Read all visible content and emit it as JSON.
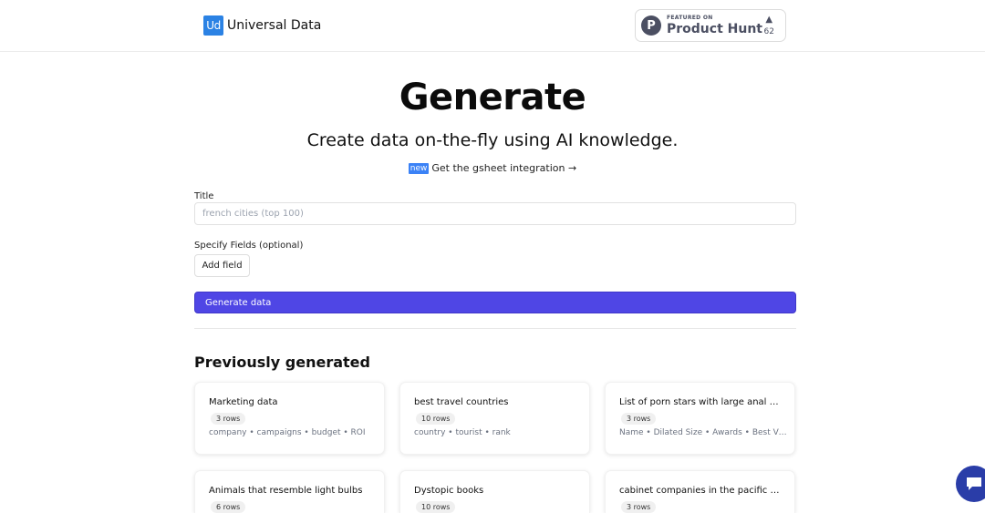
{
  "header": {
    "brand_logo": "Ud",
    "brand_name": "Universal Data",
    "product_hunt": {
      "featured": "FEATURED ON",
      "name": "Product Hunt",
      "logo_letter": "P",
      "arrow": "▲",
      "votes": "62"
    }
  },
  "hero": {
    "title": "Generate",
    "subtitle": "Create data on-the-fly using AI knowledge.",
    "new_badge": "new",
    "gsheet_link": "Get the gsheet integration →"
  },
  "form": {
    "title_label": "Title",
    "title_placeholder": "french cities (top 100)",
    "fields_label": "Specify Fields (optional)",
    "add_field_label": "Add field",
    "generate_label": "Generate data"
  },
  "previous": {
    "heading": "Previously generated",
    "cards": [
      {
        "title": "Marketing data",
        "rows": "3 rows",
        "fields": "company • campaigns • budget • ROI"
      },
      {
        "title": "best travel countries",
        "rows": "10 rows",
        "fields": "country • tourist • rank"
      },
      {
        "title": "List of porn stars with large anal openings",
        "rows": "3 rows",
        "fields": "Name • Dilated Size • Awards • Best Video"
      },
      {
        "title": "Animals that resemble light bulbs",
        "rows": "6 rows",
        "fields": ""
      },
      {
        "title": "Dystopic books",
        "rows": "10 rows",
        "fields": ""
      },
      {
        "title": "cabinet companies in the pacific northwest",
        "rows": "3 rows",
        "fields": ""
      }
    ]
  },
  "colors": {
    "accent": "#4f46e5",
    "brand": "#2b82e4",
    "chat": "#2a3da8"
  }
}
